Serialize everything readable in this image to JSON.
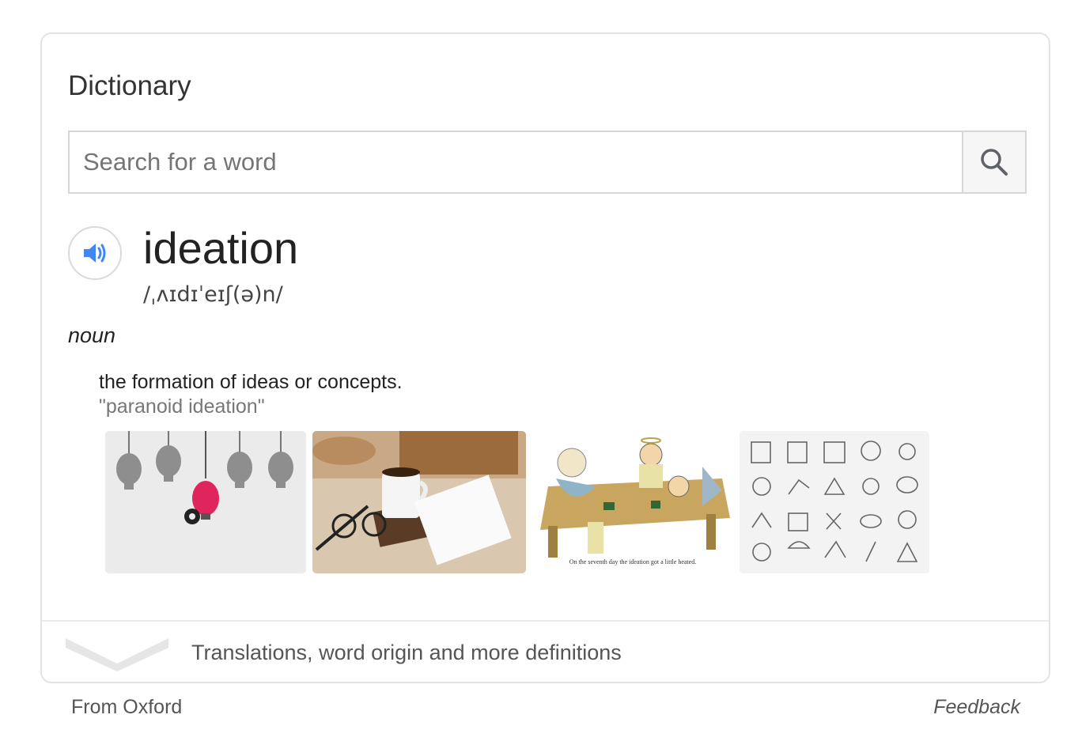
{
  "title": "Dictionary",
  "search": {
    "placeholder": "Search for a word",
    "value": ""
  },
  "icons": {
    "search": "search-icon",
    "speaker": "speaker-icon",
    "expand": "chevron-down-icon"
  },
  "entry": {
    "word": "ideation",
    "phonetic": "/ˌʌɪdɪˈeɪʃ(ə)n/",
    "part_of_speech": "noun",
    "definition": "the formation of ideas or concepts.",
    "example": "\"paranoid ideation\""
  },
  "images": [
    {
      "name": "lightbulb-brains-image"
    },
    {
      "name": "coffee-notebook-glasses-image"
    },
    {
      "name": "cartoon-angels-table-image",
      "caption": "On the seventh day the ideation got a little heated."
    },
    {
      "name": "ideation-icons-grid-image"
    }
  ],
  "more_link": "Translations, word origin and more definitions",
  "footer": {
    "source": "From Oxford",
    "feedback": "Feedback"
  },
  "colors": {
    "accent": "#4285f4",
    "border": "#e3e3e3"
  }
}
